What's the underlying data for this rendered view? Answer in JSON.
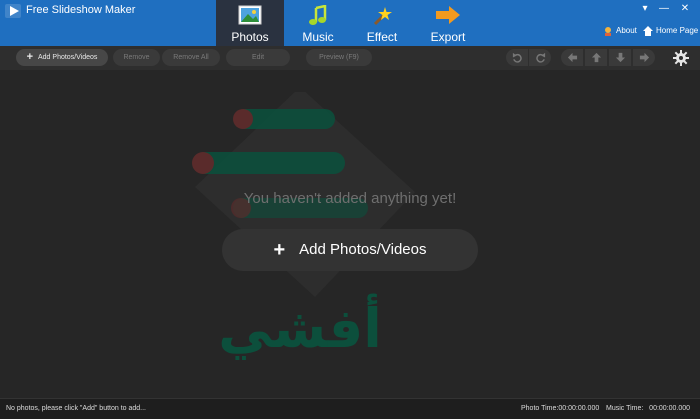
{
  "app": {
    "title": "Free Slideshow Maker"
  },
  "nav": {
    "tabs": [
      {
        "label": "Photos",
        "icon": "photo-icon",
        "active": true
      },
      {
        "label": "Music",
        "icon": "music-note-icon"
      },
      {
        "label": "Effect",
        "icon": "magic-wand-icon"
      },
      {
        "label": "Export",
        "icon": "arrow-right-icon"
      }
    ],
    "about": "About",
    "home": "Home Page"
  },
  "window_controls": {
    "dropdown": "▾",
    "minimize": "—",
    "close": "✕"
  },
  "toolbar": {
    "add": "Add Photos/Videos",
    "remove": "Remove",
    "remove_all": "Remove All",
    "edit": "Edit",
    "preview": "Preview (F9)"
  },
  "main": {
    "empty_message": "You haven't added anything yet!",
    "add_button": "Add Photos/Videos",
    "watermark_text": "أفشي"
  },
  "status": {
    "message": "No photos, please click \"Add\" button to add...",
    "photo_time": "Photo Time:00:00:00.000",
    "music_time": "Music Time:   00:00:00.000"
  },
  "colors": {
    "accent": "#1f6fc0",
    "background": "#262626",
    "active_tab": "#2a3240"
  }
}
